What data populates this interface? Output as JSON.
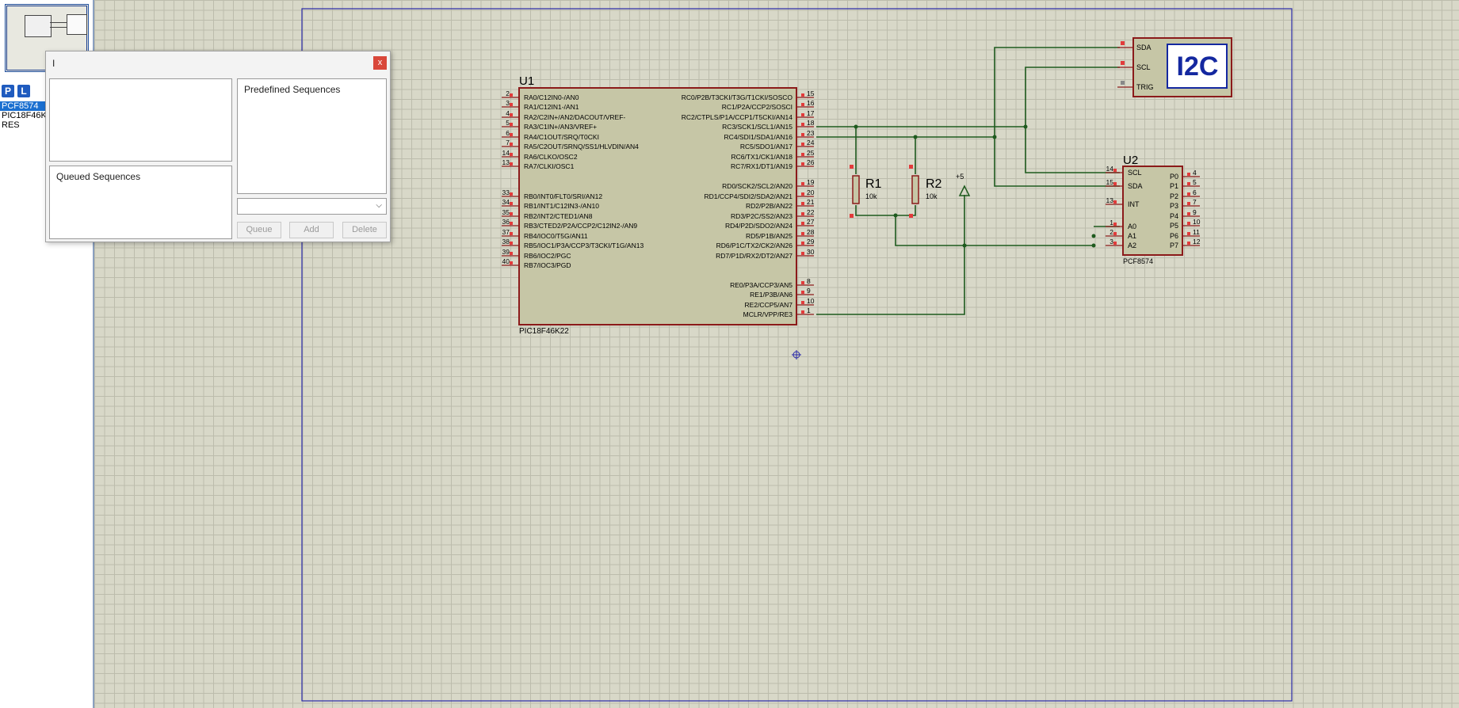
{
  "left_panel": {
    "mode_buttons": [
      "P",
      "L"
    ],
    "devices": [
      "PCF8574",
      "PIC18F46K",
      "RES"
    ],
    "selected_index": 0
  },
  "dialog": {
    "title": "I",
    "close_label": "x",
    "predefined_label": "Predefined Sequences",
    "queued_label": "Queued Sequences",
    "buttons": {
      "queue": "Queue",
      "add": "Add",
      "delete": "Delete"
    }
  },
  "schematic": {
    "u1": {
      "ref": "U1",
      "part": "PIC18F46K22",
      "left_pins": [
        {
          "num": "2",
          "name": "RA0/C12IN0-/AN0"
        },
        {
          "num": "3",
          "name": "RA1/C12IN1-/AN1"
        },
        {
          "num": "4",
          "name": "RA2/C2IN+/AN2/DACOUT/VREF-"
        },
        {
          "num": "5",
          "name": "RA3/C1IN+/AN3/VREF+"
        },
        {
          "num": "6",
          "name": "RA4/C1OUT/SRQ/T0CKI"
        },
        {
          "num": "7",
          "name": "RA5/C2OUT/SRNQ/SS1/HLVDIN/AN4"
        },
        {
          "num": "14",
          "name": "RA6/CLKO/OSC2"
        },
        {
          "num": "13",
          "name": "RA7/CLKI/OSC1"
        },
        {
          "num": "33",
          "name": "RB0/INT0/FLT0/SRI/AN12"
        },
        {
          "num": "34",
          "name": "RB1/INT1/C12IN3-/AN10"
        },
        {
          "num": "35",
          "name": "RB2/INT2/CTED1/AN8"
        },
        {
          "num": "36",
          "name": "RB3/CTED2/P2A/CCP2/C12IN2-/AN9"
        },
        {
          "num": "37",
          "name": "RB4/IOC0/T5G/AN11"
        },
        {
          "num": "38",
          "name": "RB5/IOC1/P3A/CCP3/T3CKI/T1G/AN13"
        },
        {
          "num": "39",
          "name": "RB6/IOC2/PGC"
        },
        {
          "num": "40",
          "name": "RB7/IOC3/PGD"
        }
      ],
      "right_pins": [
        {
          "num": "15",
          "name": "RC0/P2B/T3CKI/T3G/T1CKI/SOSCO"
        },
        {
          "num": "16",
          "name": "RC1/P2A/CCP2/SOSCI"
        },
        {
          "num": "17",
          "name": "RC2/CTPLS/P1A/CCP1/T5CKI/AN14"
        },
        {
          "num": "18",
          "name": "RC3/SCK1/SCL1/AN15"
        },
        {
          "num": "23",
          "name": "RC4/SDI1/SDA1/AN16"
        },
        {
          "num": "24",
          "name": "RC5/SDO1/AN17"
        },
        {
          "num": "25",
          "name": "RC6/TX1/CK1/AN18"
        },
        {
          "num": "26",
          "name": "RC7/RX1/DT1/AN19"
        },
        {
          "num": "19",
          "name": "RD0/SCK2/SCL2/AN20"
        },
        {
          "num": "20",
          "name": "RD1/CCP4/SDI2/SDA2/AN21"
        },
        {
          "num": "21",
          "name": "RD2/P2B/AN22"
        },
        {
          "num": "22",
          "name": "RD3/P2C/SS2/AN23"
        },
        {
          "num": "27",
          "name": "RD4/P2D/SDO2/AN24"
        },
        {
          "num": "28",
          "name": "RD5/P1B/AN25"
        },
        {
          "num": "29",
          "name": "RD6/P1C/TX2/CK2/AN26"
        },
        {
          "num": "30",
          "name": "RD7/P1D/RX2/DT2/AN27"
        },
        {
          "num": "8",
          "name": "RE0/P3A/CCP3/AN5"
        },
        {
          "num": "9",
          "name": "RE1/P3B/AN6"
        },
        {
          "num": "10",
          "name": "RE2/CCP5/AN7"
        },
        {
          "num": "1",
          "name": "MCLR/VPP/RE3"
        }
      ]
    },
    "r1": {
      "ref": "R1",
      "value": "10k"
    },
    "r2": {
      "ref": "R2",
      "value": "10k"
    },
    "power_label": "+5",
    "u2": {
      "ref": "U2",
      "part": "PCF8574",
      "left_pins": [
        {
          "num": "14",
          "name": "SCL"
        },
        {
          "num": "15",
          "name": "SDA"
        },
        {
          "num": "13",
          "name": "INT"
        },
        {
          "num": "1",
          "name": "A0"
        },
        {
          "num": "2",
          "name": "A1"
        },
        {
          "num": "3",
          "name": "A2"
        }
      ],
      "right_pins": [
        {
          "num": "4",
          "name": "P0"
        },
        {
          "num": "5",
          "name": "P1"
        },
        {
          "num": "6",
          "name": "P2"
        },
        {
          "num": "7",
          "name": "P3"
        },
        {
          "num": "9",
          "name": "P4"
        },
        {
          "num": "10",
          "name": "P5"
        },
        {
          "num": "11",
          "name": "P6"
        },
        {
          "num": "12",
          "name": "P7"
        }
      ]
    },
    "i2c_debugger": {
      "title": "I2C",
      "pins": [
        "SDA",
        "SCL",
        "TRIG"
      ]
    }
  },
  "colors": {
    "body_fill": "#c6c6a6",
    "outline": "#8b1a1a",
    "wire": "#1e5a1e",
    "pin_mark": "#e23b3b",
    "border": "#2a2aa8",
    "i2c_text": "#1428a0"
  }
}
